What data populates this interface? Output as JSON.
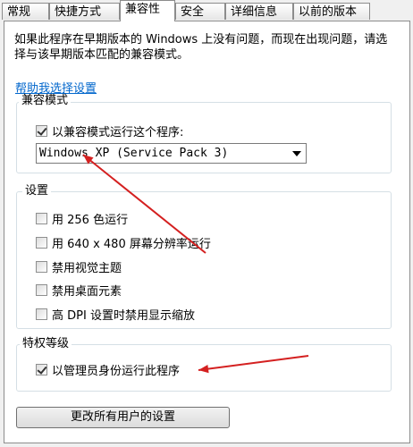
{
  "tabs": [
    {
      "label": "常规"
    },
    {
      "label": "快捷方式"
    },
    {
      "label": "兼容性"
    },
    {
      "label": "安全"
    },
    {
      "label": "详细信息"
    },
    {
      "label": "以前的版本"
    }
  ],
  "intro_text": "如果此程序在早期版本的 Windows 上没有问题，而现在出现问题，请选择与该早期版本匹配的兼容模式。",
  "help_link": "帮助我选择设置",
  "compat_mode": {
    "title": "兼容模式",
    "checkbox_label": "以兼容模式运行这个程序:",
    "checked": true,
    "selected_os": "Windows XP (Service Pack 3)"
  },
  "settings": {
    "title": "设置",
    "options": [
      {
        "label": "用 256 色运行",
        "checked": false
      },
      {
        "label": "用 640 x 480 屏幕分辨率运行",
        "checked": false
      },
      {
        "label": "禁用视觉主题",
        "checked": false
      },
      {
        "label": "禁用桌面元素",
        "checked": false
      },
      {
        "label": "高 DPI 设置时禁用显示缩放",
        "checked": false
      }
    ]
  },
  "privilege": {
    "title": "特权等级",
    "checkbox_label": "以管理员身份运行此程序",
    "checked": true
  },
  "change_all_button": "更改所有用户的设置",
  "colors": {
    "arrow": "#d42020",
    "link": "#0066cc"
  }
}
